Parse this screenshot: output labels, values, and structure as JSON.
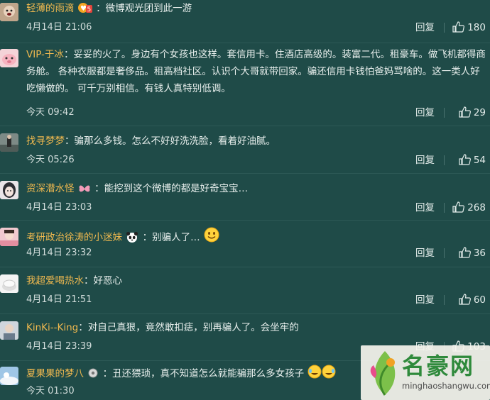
{
  "comments": [
    {
      "user": "轻薄的雨滴",
      "badge": "vip-s5-badge",
      "text": "：微博观光团到此一游",
      "time": "4月14日 21:06",
      "reply": "回复",
      "likes": "180"
    },
    {
      "user": "VIP-于冰",
      "badge": "",
      "text": "：妥妥的火了。身边有个女孩也这样。套信用卡。住酒店高级的。装富二代。租豪车。做飞机都得商务舱。 各种衣服都是奢侈品。租高档社区。认识个大哥就带回家。骗还信用卡钱怕爸妈骂啥的。这一类人好吃懒做的。 可千万别相信。有钱人真特别低调。",
      "time": "今天 09:42",
      "reply": "回复",
      "likes": "29"
    },
    {
      "user": "找寻梦梦",
      "badge": "",
      "text": "：骗那么多钱。怎么不好好洗洗脸，看着好油腻。",
      "time": "今天 05:26",
      "reply": "回复",
      "likes": "54"
    },
    {
      "user": "资深潜水怪",
      "badge": "butterfly-badge",
      "text": "：能挖到这个微博的都是好奇宝宝…",
      "time": "4月14日 23:03",
      "reply": "回复",
      "likes": "268"
    },
    {
      "user": "考研政治徐涛的小迷妹",
      "badge": "panda-badge",
      "text": "：别骗人了…",
      "time": "4月14日 23:32",
      "reply": "回复",
      "likes": "36"
    },
    {
      "user": "我超爱喝热水",
      "badge": "",
      "text": "：好恶心",
      "time": "4月14日 21:51",
      "reply": "回复",
      "likes": "60"
    },
    {
      "user": "KinKi--King",
      "badge": "",
      "text": "：对自己真狠，竟然敢扣痣，别再骗人了。会坐牢的",
      "time": "4月14日 23:39",
      "reply": "回复",
      "likes": "103"
    },
    {
      "user": "夏果果的梦八",
      "badge": "gear-badge",
      "text": "：丑还猥琐，真不知道怎么就能骗那么多女孩子",
      "time": "今天 01:30",
      "reply": "回复",
      "likes": ""
    }
  ],
  "watermark": {
    "brand": "名豪网",
    "url": "minghaoshangwu.com"
  }
}
